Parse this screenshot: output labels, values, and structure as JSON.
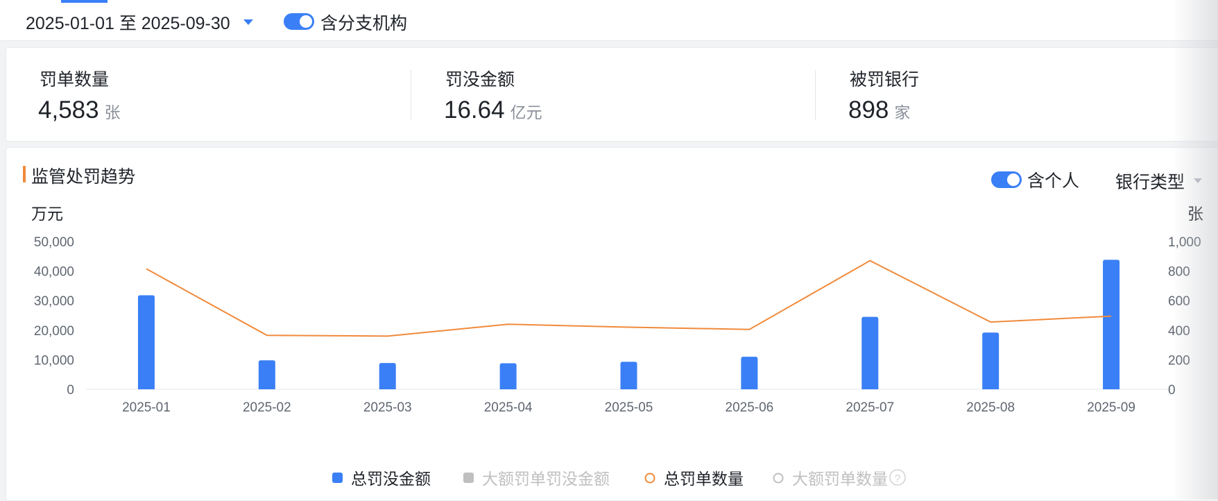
{
  "filters": {
    "date_range": "2025-01-01 至 2025-09-30",
    "include_branches_label": "含分支机构",
    "include_branches": true
  },
  "stats": [
    {
      "label": "罚单数量",
      "value": "4,583",
      "unit": "张"
    },
    {
      "label": "罚没金额",
      "value": "16.64",
      "unit": "亿元"
    },
    {
      "label": "被罚银行",
      "value": "898",
      "unit": "家"
    }
  ],
  "chart_section": {
    "title": "监管处罚趋势",
    "include_individual_label": "含个人",
    "include_individual": true,
    "bank_type_label": "银行类型"
  },
  "colors": {
    "accent": "#3a7ff6",
    "bar": "#3a7ff6",
    "line": "#f08a3c",
    "title_marker": "#f08a3c",
    "legend_disabled": "#bfbfbf"
  },
  "chart_data": {
    "type": "bar",
    "categories": [
      "2025-01",
      "2025-02",
      "2025-03",
      "2025-04",
      "2025-05",
      "2025-06",
      "2025-07",
      "2025-08",
      "2025-09"
    ],
    "ylabel": "万元",
    "y2label": "张",
    "ylim": [
      0,
      50000
    ],
    "y2lim": [
      0,
      1000
    ],
    "yticks": [
      "0",
      "10,000",
      "20,000",
      "30,000",
      "40,000",
      "50,000"
    ],
    "y2ticks": [
      "0",
      "200",
      "400",
      "600",
      "800",
      "1,000"
    ],
    "grid": false,
    "legend_position": "bottom",
    "series": [
      {
        "name": "总罚没金额",
        "type": "bar",
        "axis": "left",
        "visible": true,
        "values": [
          31800,
          9800,
          8900,
          8800,
          9300,
          11000,
          24500,
          19200,
          43800
        ]
      },
      {
        "name": "大额罚单罚没金额",
        "type": "bar",
        "axis": "left",
        "visible": false,
        "values": []
      },
      {
        "name": "总罚单数量",
        "type": "line",
        "axis": "right",
        "visible": true,
        "values": [
          815,
          365,
          360,
          440,
          420,
          405,
          870,
          455,
          495
        ]
      },
      {
        "name": "大额罚单数量",
        "type": "line",
        "axis": "right",
        "visible": false,
        "values": []
      }
    ],
    "legend_help_icon": "question-circle-icon"
  }
}
